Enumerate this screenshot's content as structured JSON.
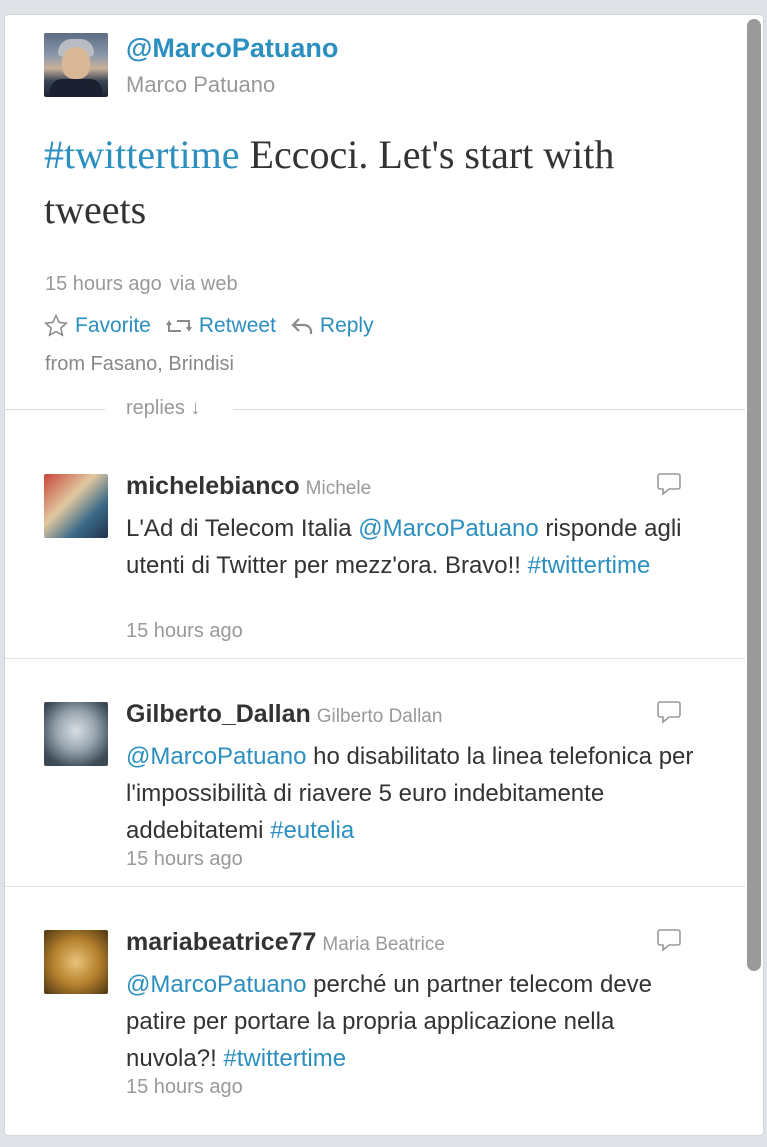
{
  "main_tweet": {
    "handle": "@MarcoPatuano",
    "full_name": "Marco Patuano",
    "text_hashtag": "#twittertime",
    "text_rest": " Eccoci. Let's start with tweets",
    "time": "15 hours ago",
    "via": "via web",
    "actions": {
      "favorite": "Favorite",
      "retweet": "Retweet",
      "reply": "Reply"
    },
    "location": "from Fasano, Brindisi"
  },
  "replies_label": "replies ↓",
  "replies": [
    {
      "username": "michelebianco",
      "name": "Michele",
      "text_before": "L'Ad di Telecom Italia ",
      "mention": "@MarcoPatuano",
      "text_after": " risponde agli utenti di Twitter per mezz'ora. Bravo!! ",
      "hashtag": "#twittertime",
      "time": "15 hours ago"
    },
    {
      "username": "Gilberto_Dallan",
      "name": "Gilberto Dallan",
      "mention": "@MarcoPatuano",
      "text_after": " ho disabilitato la linea telefonica per l'impossibilità di riavere 5 euro indebitamente addebitatemi ",
      "hashtag": "#eutelia",
      "time": "15 hours ago"
    },
    {
      "username": "mariabeatrice77",
      "name": "Maria Beatrice",
      "mention": "@MarcoPatuano",
      "text_after": " perché un partner telecom deve patire per portare la propria applicazione nella nuvola?! ",
      "hashtag": "#twittertime",
      "time": "15 hours ago"
    }
  ],
  "colors": {
    "link": "#2b8fbf",
    "text": "#333333",
    "muted": "#999999"
  },
  "icons": [
    "star-icon",
    "retweet-icon",
    "reply-arrow-icon",
    "speech-bubble-icon"
  ]
}
